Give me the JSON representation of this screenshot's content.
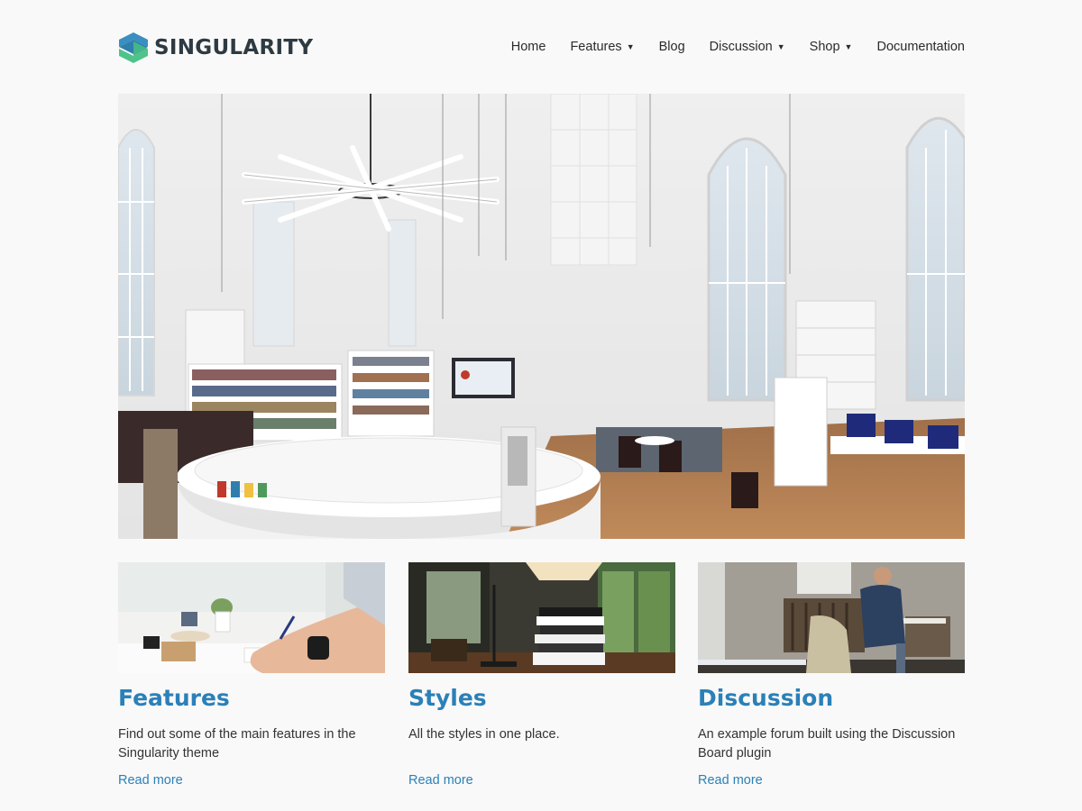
{
  "brand": {
    "name": "SINGULARITY",
    "colors": {
      "mark_top": "#2f7fae",
      "mark_bottom": "#4fc38a",
      "text": "#2e3a42"
    }
  },
  "nav": {
    "items": [
      {
        "label": "Home",
        "dropdown": false
      },
      {
        "label": "Features",
        "dropdown": true
      },
      {
        "label": "Blog",
        "dropdown": false
      },
      {
        "label": "Discussion",
        "dropdown": true
      },
      {
        "label": "Shop",
        "dropdown": true
      },
      {
        "label": "Documentation",
        "dropdown": false
      }
    ],
    "caret_icon": "caret-down-icon"
  },
  "hero": {
    "image": "library-interior-photo"
  },
  "cards": [
    {
      "title": "Features",
      "description": "Find out some of the main features in the Singularity theme",
      "link": "Read more",
      "image": "writing-desk-photo"
    },
    {
      "title": "Styles",
      "description": "All the styles in one place.",
      "link": "Read more",
      "image": "stacked-books-lamp-photo"
    },
    {
      "title": "Discussion",
      "description": "An example forum built using the Discussion Board plugin",
      "link": "Read more",
      "image": "person-reading-photo"
    }
  ],
  "colors": {
    "accent": "#2b80b8",
    "text": "#2b2b2b",
    "background": "#f9f9f9"
  }
}
